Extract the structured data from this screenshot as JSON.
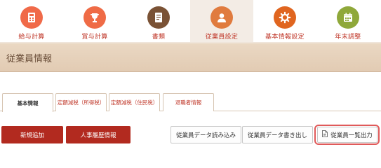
{
  "nav": {
    "items": [
      {
        "label": "給与計算",
        "icon": "calculator-icon",
        "color": "#f06a49"
      },
      {
        "label": "賞与計算",
        "icon": "trophy-icon",
        "color": "#ef6b46"
      },
      {
        "label": "書類",
        "icon": "document-icon",
        "color": "#7a5235"
      },
      {
        "label": "従業員設定",
        "icon": "user-icon",
        "color": "#e07b3e"
      },
      {
        "label": "基本情報設定",
        "icon": "gear-icon",
        "color": "#e0651f"
      },
      {
        "label": "年末調整",
        "icon": "calendar-icon",
        "color": "#8fa83a"
      }
    ],
    "active_index": 3
  },
  "page": {
    "title": "従業員情報"
  },
  "tabs": [
    {
      "label": "基本情報",
      "active": true
    },
    {
      "label": "定額減税（所得税）",
      "active": false
    },
    {
      "label": "定額減税（住民税）",
      "active": false
    },
    {
      "label": "退職者情報",
      "active": false
    }
  ],
  "actions": {
    "add_new": "新規追加",
    "hr_history": "人事履歴情報",
    "import_data": "従業員データ読み込み",
    "export_data": "従業員データ書き出し",
    "export_list": "従業員一覧出力"
  },
  "colors": {
    "accent_red": "#b22a1f",
    "nav_label_red": "#c0392b",
    "header_bg": "#e6d2bd",
    "highlight": "#e05a5a"
  }
}
